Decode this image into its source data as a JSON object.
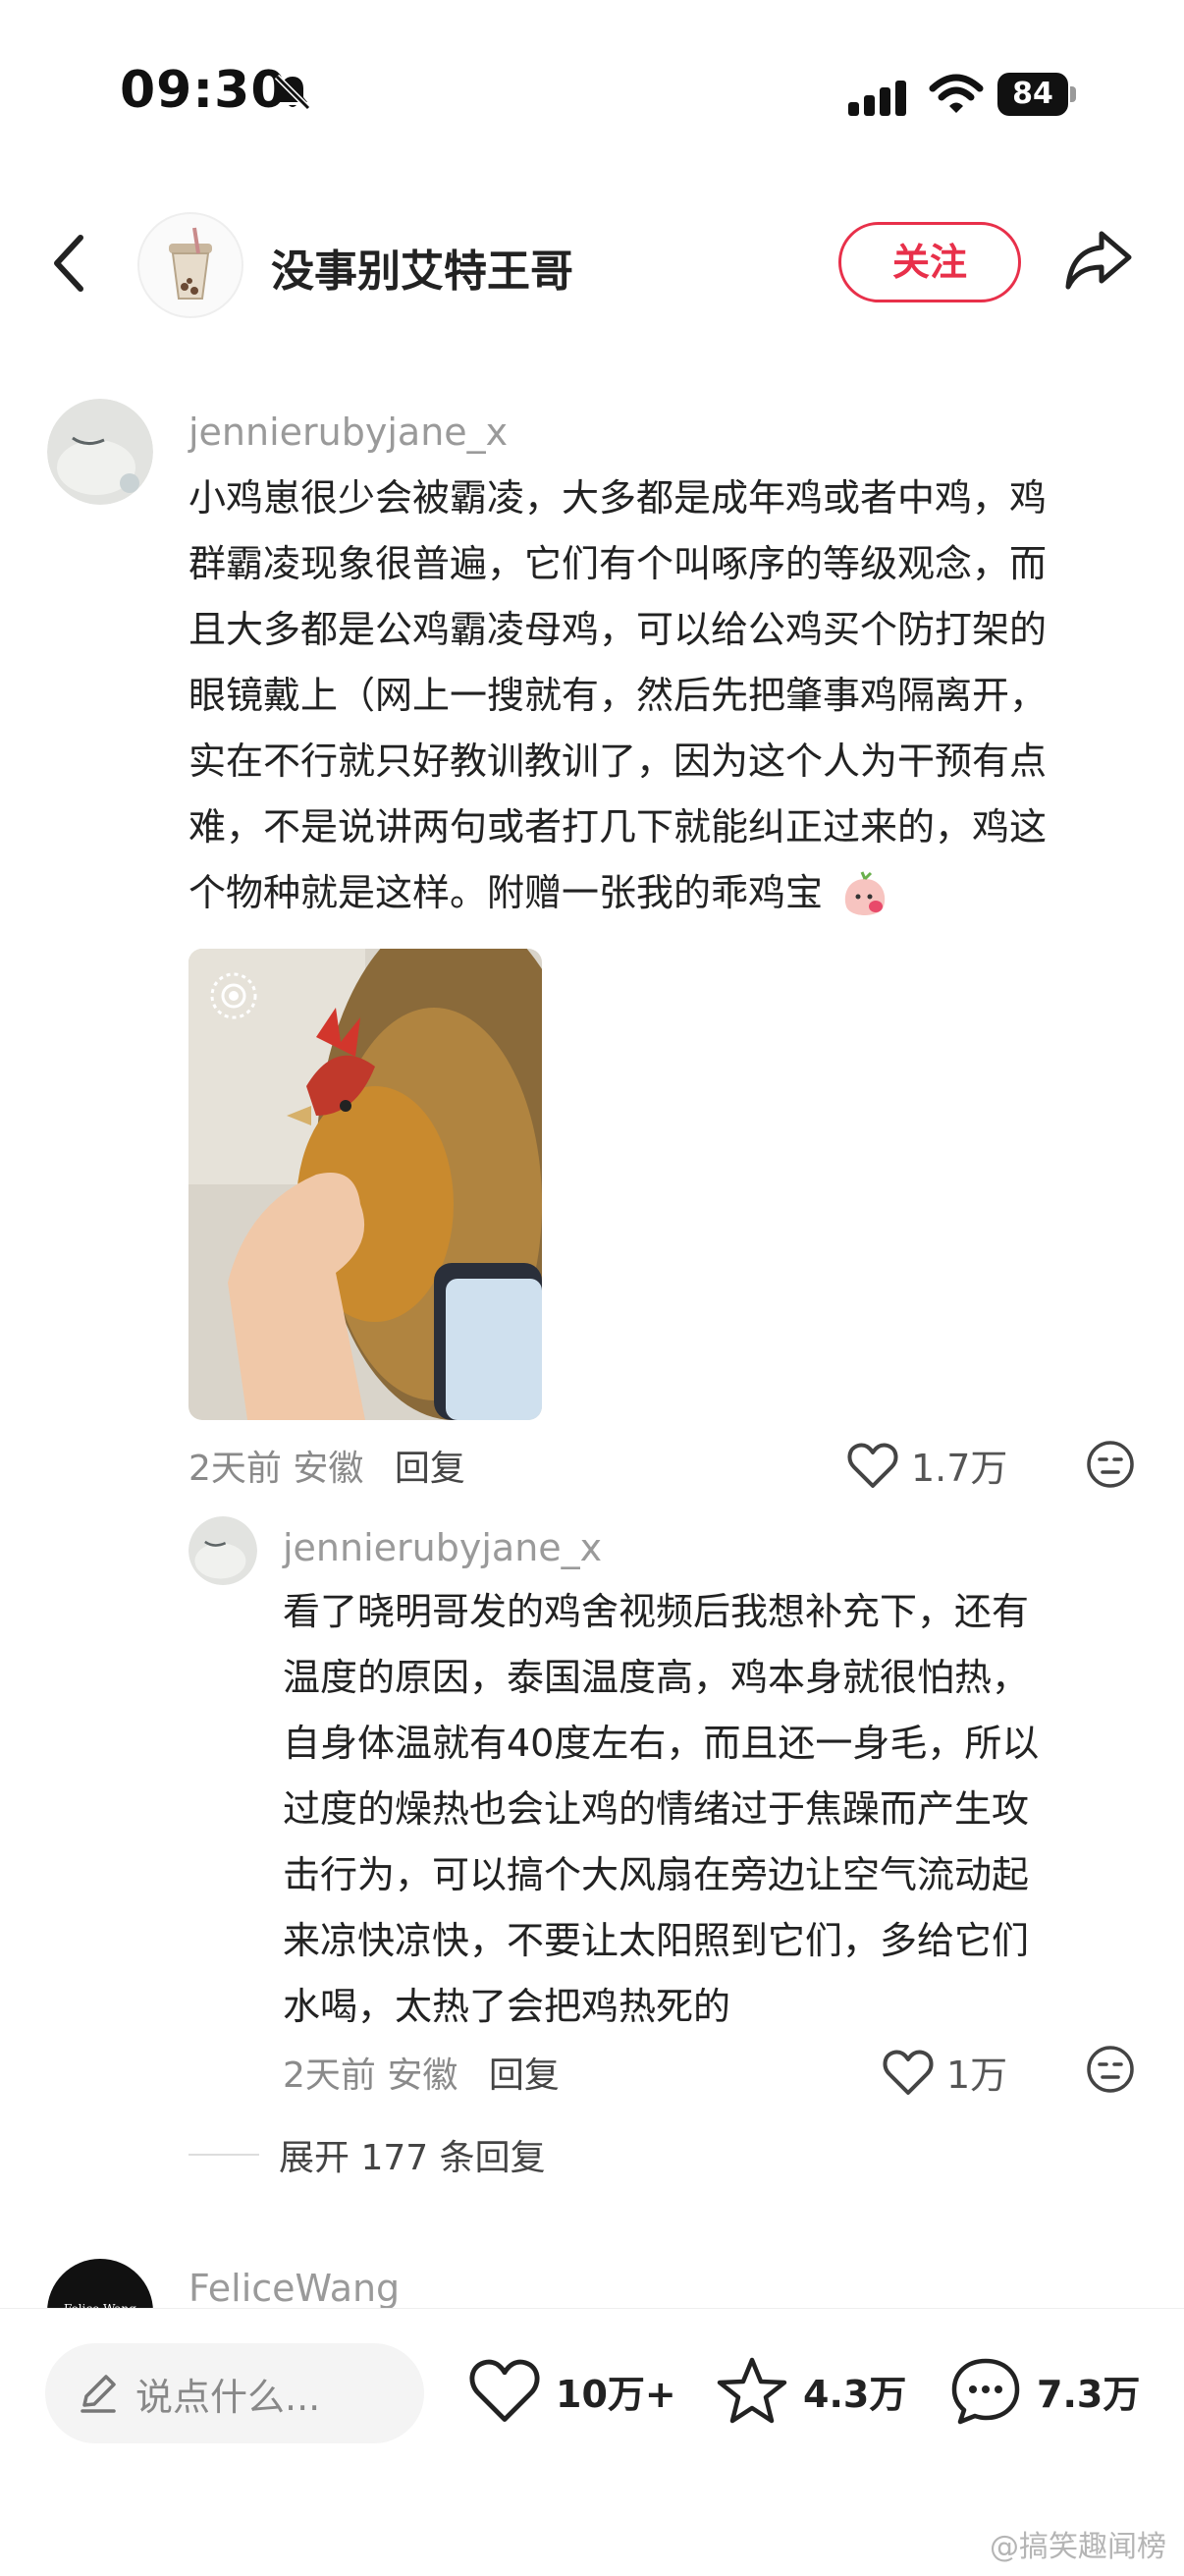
{
  "status_bar": {
    "time": "09:30",
    "battery": "84"
  },
  "header": {
    "name": "没事别艾特王哥",
    "follow_label": "关注"
  },
  "comments": [
    {
      "username": "jennierubyjane_x",
      "lines": [
        "小鸡崽很少会被霸凌，大多都是成年鸡或者中鸡，鸡",
        "群霸凌现象很普遍，它们有个叫啄序的等级观念，而",
        "且大多都是公鸡霸凌母鸡，可以给公鸡买个防打架的",
        "眼镜戴上（网上一搜就有，然后先把肇事鸡隔离开，",
        "实在不行就只好教训教训了，因为这个人为干预有点",
        "难，不是说讲两句或者打几下就能纠正过来的，鸡这",
        "个物种就是这样。附赠一张我的乖鸡宝"
      ],
      "time": "2天前",
      "location": "安徽",
      "reply_label": "回复",
      "likes": "1.7万",
      "replies": [
        {
          "username": "jennierubyjane_x",
          "lines": [
            "看了晓明哥发的鸡舍视频后我想补充下，还有",
            "温度的原因，泰国温度高，鸡本身就很怕热，",
            "自身体温就有40度左右，而且还一身毛，所以",
            "过度的燥热也会让鸡的情绪过于焦躁而产生攻",
            "击行为，可以搞个大风扇在旁边让空气流动起",
            "来凉快凉快，不要让太阳照到它们，多给它们",
            "水喝，太热了会把鸡热死的"
          ],
          "time": "2天前",
          "location": "安徽",
          "reply_label": "回复",
          "likes": "1万"
        }
      ],
      "expand_label": "展开 177 条回复"
    },
    {
      "username": "FeliceWang",
      "avatar_text": "Felice Wang"
    }
  ],
  "bottom_bar": {
    "input_placeholder": "说点什么...",
    "likes": "10万+",
    "favorites": "4.3万",
    "comments": "7.3万"
  },
  "watermark": "@搞笑趣闻榜",
  "colors": {
    "accent": "#e8304a",
    "muted": "#9a9a9a"
  }
}
